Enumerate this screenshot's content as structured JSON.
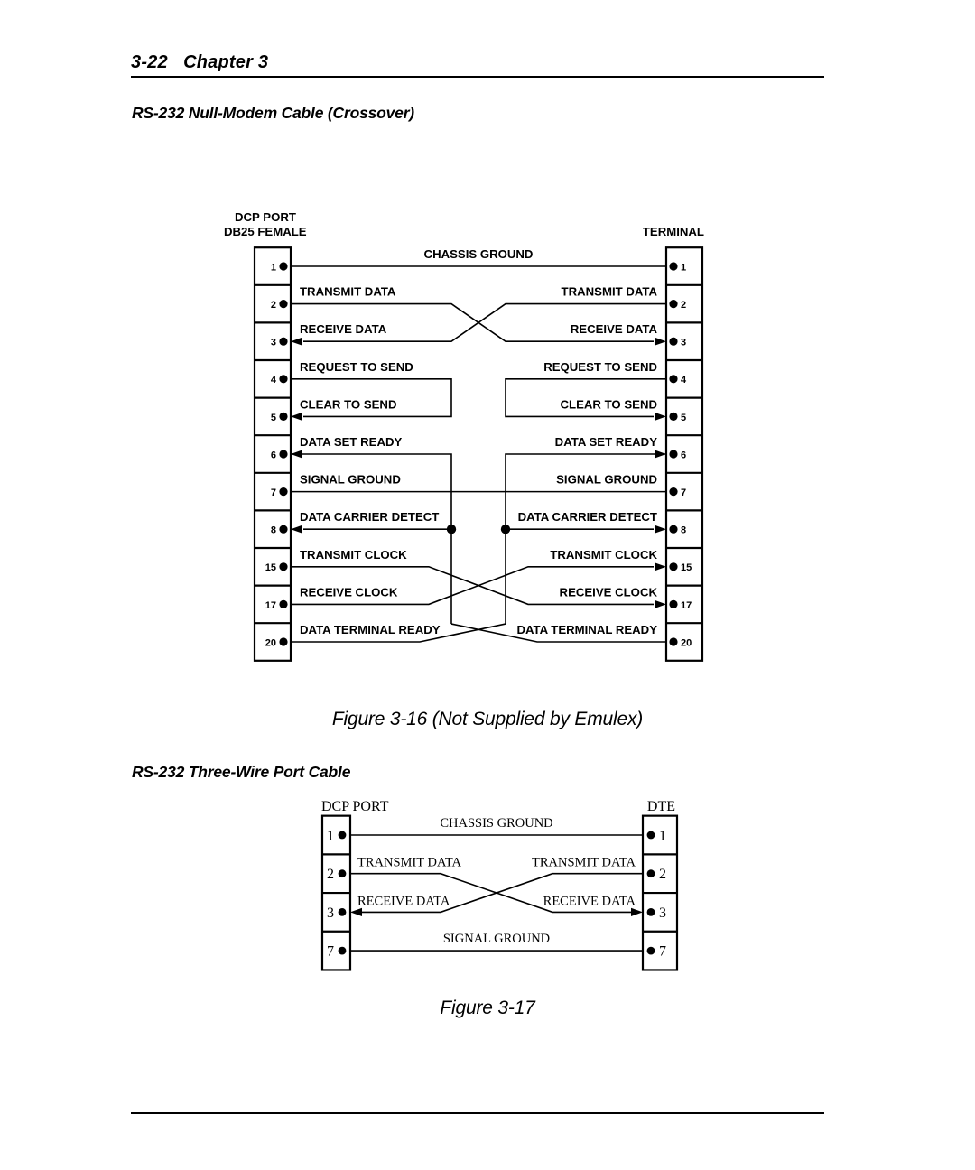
{
  "page": {
    "number": "3-22",
    "chapter_label": "Chapter 3",
    "header_text": "3-22   Chapter 3"
  },
  "sections": [
    {
      "heading": "RS-232 Null-Modem Cable (Crossover)",
      "caption": "Figure 3-16 (Not Supplied by Emulex)"
    },
    {
      "heading": "RS-232 Three-Wire Port Cable",
      "caption": "Figure 3-17"
    }
  ],
  "diagram_null_modem": {
    "left_connector_label_line1": "DCP PORT",
    "left_connector_label_line2": "DB25 FEMALE",
    "right_connector_label": "TERMINAL",
    "pins": [
      "1",
      "2",
      "3",
      "4",
      "5",
      "6",
      "7",
      "8",
      "15",
      "17",
      "20"
    ],
    "signals": [
      {
        "pin": "1",
        "left_label": "",
        "right_label": "",
        "center_label": "CHASSIS GROUND",
        "wiring": "straight-center-label"
      },
      {
        "pin": "2",
        "left_label": "TRANSMIT DATA",
        "right_label": "TRANSMIT DATA",
        "center_label": "",
        "wiring": "crossover-tx"
      },
      {
        "pin": "3",
        "left_label": "RECEIVE DATA",
        "right_label": "RECEIVE DATA",
        "center_label": "",
        "wiring": "crossover-rx"
      },
      {
        "pin": "4",
        "left_label": "REQUEST TO SEND",
        "right_label": "REQUEST TO SEND",
        "center_label": "",
        "wiring": "loop-top"
      },
      {
        "pin": "5",
        "left_label": "CLEAR TO SEND",
        "right_label": "CLEAR TO SEND",
        "center_label": "",
        "wiring": "loop-bottom"
      },
      {
        "pin": "6",
        "left_label": "DATA SET READY",
        "right_label": "DATA SET READY",
        "center_label": "",
        "wiring": "loop-top"
      },
      {
        "pin": "7",
        "left_label": "SIGNAL GROUND",
        "right_label": "SIGNAL GROUND",
        "center_label": "",
        "wiring": "straight"
      },
      {
        "pin": "8",
        "left_label": "DATA CARRIER DETECT",
        "right_label": "DATA CARRIER DETECT",
        "center_label": "",
        "wiring": "loop-bottom-junction"
      },
      {
        "pin": "15",
        "left_label": "TRANSMIT CLOCK",
        "right_label": "TRANSMIT CLOCK",
        "center_label": "",
        "wiring": "crossover-clock-tx"
      },
      {
        "pin": "17",
        "left_label": "RECEIVE CLOCK",
        "right_label": "RECEIVE CLOCK",
        "center_label": "",
        "wiring": "crossover-clock-rx"
      },
      {
        "pin": "20",
        "left_label": "DATA TERMINAL READY",
        "right_label": "DATA TERMINAL READY",
        "center_label": "",
        "wiring": "dtr-cross-to-loop"
      }
    ]
  },
  "diagram_three_wire": {
    "left_connector_label": "DCP PORT",
    "right_connector_label": "DTE",
    "pins": [
      "1",
      "2",
      "3",
      "7"
    ],
    "signals": [
      {
        "pin": "1",
        "left_label": "",
        "right_label": "",
        "center_label": "CHASSIS GROUND",
        "wiring": "straight-center-label"
      },
      {
        "pin": "2",
        "left_label": "TRANSMIT DATA",
        "right_label": "TRANSMIT DATA",
        "center_label": "",
        "wiring": "crossover-tx"
      },
      {
        "pin": "3",
        "left_label": "RECEIVE DATA",
        "right_label": "RECEIVE DATA",
        "center_label": "",
        "wiring": "crossover-rx"
      },
      {
        "pin": "7",
        "left_label": "",
        "right_label": "",
        "center_label": "SIGNAL GROUND",
        "wiring": "straight-center-label"
      }
    ]
  },
  "colors": {
    "ink": "#000000",
    "paper": "#ffffff"
  }
}
